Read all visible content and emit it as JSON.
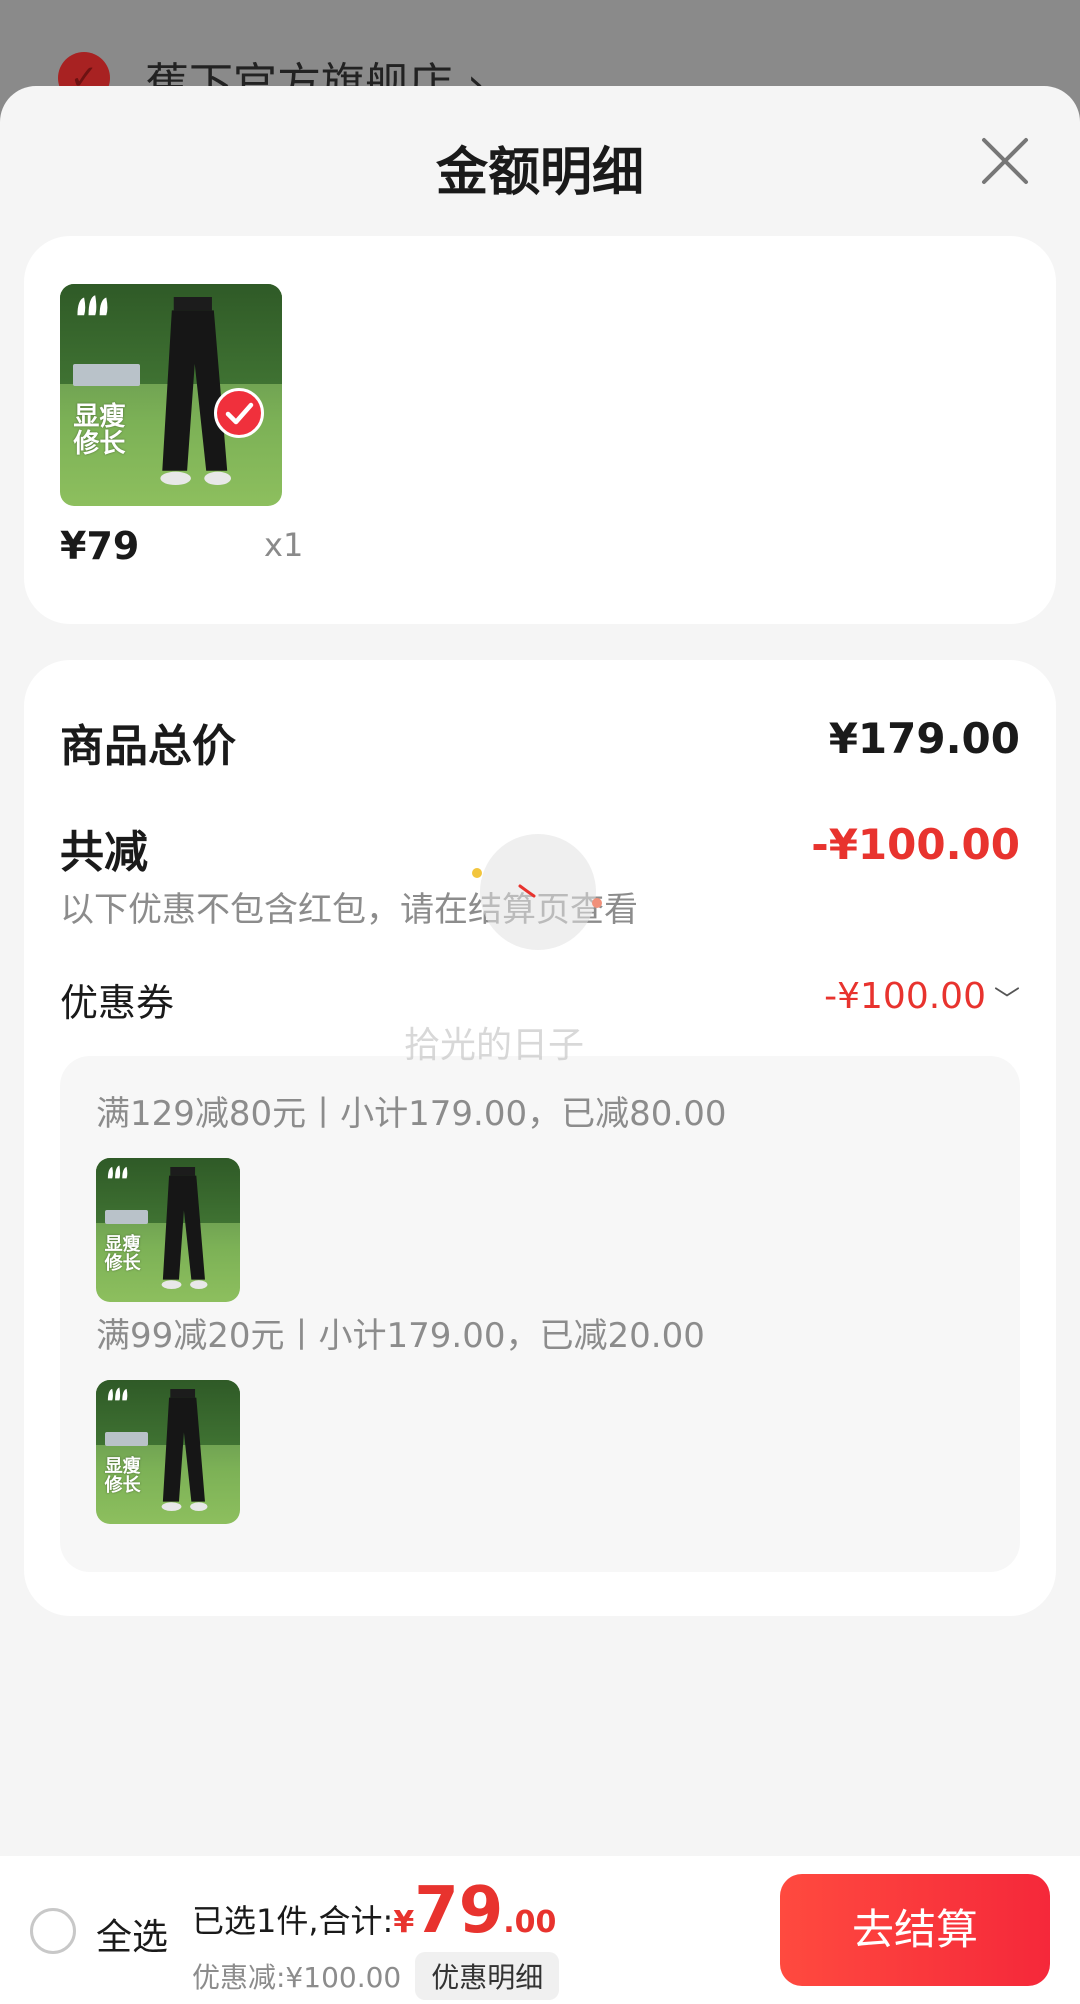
{
  "backdrop": {
    "store_name": "蕉下官方旗舰店 ›"
  },
  "sheet": {
    "title": "金额明细",
    "item": {
      "price": "¥79",
      "quantity": "x1",
      "tag_line1": "显瘦",
      "tag_line2": "修长"
    },
    "summary": {
      "total_label": "商品总价",
      "total_value": "¥179.00",
      "reduce_label": "共减",
      "reduce_value": "-¥100.00",
      "note": "以下优惠不包含红包，请在结算页查看",
      "coupon_label": "优惠券",
      "coupon_value": "-¥100.00"
    },
    "coupons": [
      {
        "text": "满129减80元丨小计179.00，已减80.00"
      },
      {
        "text": "满99减20元丨小计179.00，已减20.00"
      }
    ],
    "watermark": "拾光的日子"
  },
  "bottom_bar": {
    "select_all": "全选",
    "selected_text": "已选1件,合计:",
    "currency": "¥",
    "amount_int": "79",
    "amount_dec": ".00",
    "discount_text": "优惠减:¥100.00",
    "detail_button": "优惠明细",
    "checkout_button": "去结算"
  },
  "colors": {
    "accent": "#e8332e",
    "checkout": "#f5283a",
    "background": "#f5f5f5"
  }
}
